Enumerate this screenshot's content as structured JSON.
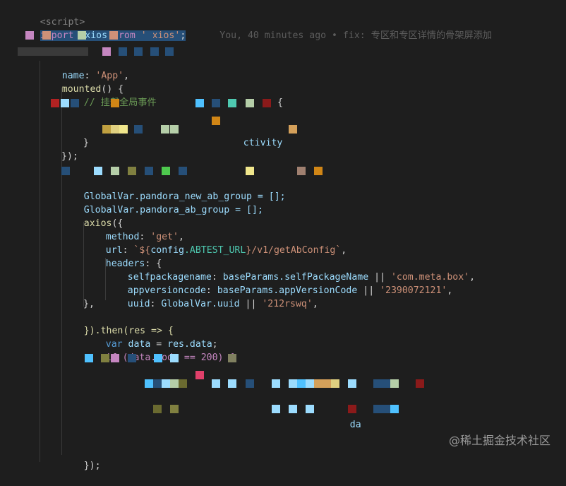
{
  "code": {
    "script_open": "<script>",
    "import_kw": "import",
    "import_name": "axios",
    "import_from": "from",
    "import_str": "'axios'",
    "import_semi": ";",
    "blame_text": "You, 40 minutes ago • fix: 专区和专区详情的骨架屏添加",
    "name_key": "name",
    "name_val": "'App'",
    "mounted_fn": "mounted",
    "comment_text": "// 挂载全局事件",
    "if_kw": "if",
    "activity_fragment": "ctivity",
    "ab_group_line": "GlobalVar.pandora_new_ab_group = [];",
    "ab_group2_line": "GlobalVar.pandora_ab_group = [];",
    "axios_call": "axios",
    "method_key": "method",
    "method_val": "'get'",
    "url_key": "url",
    "url_tpl_open": "`${",
    "url_config": "config",
    "url_ab": ".ABTEST_URL",
    "url_tpl_close": "}/v1/getAbConfig`",
    "headers_key": "headers",
    "selfpackagename_key": "selfpackagename",
    "selfpackagename_expr": "baseParams.selfPackageName",
    "selfpackagename_str": "'com.meta.box'",
    "appversioncode_key": "appversioncode",
    "appversioncode_expr": "baseParams.appVersionCode",
    "appversioncode_str": "'2390072121'",
    "uuid_key": "uuid",
    "uuid_expr": "GlobalVar.uuid",
    "uuid_str": "'212rswq'",
    "then_text": "}).then(res => {",
    "var_kw": "var",
    "data_var": "data",
    "res_data": "res.data",
    "if_data_code": "if (data.code == 200) {",
    "data_fragment": "da",
    "close_paren": "});"
  },
  "watermark": "@稀土掘金技术社区"
}
